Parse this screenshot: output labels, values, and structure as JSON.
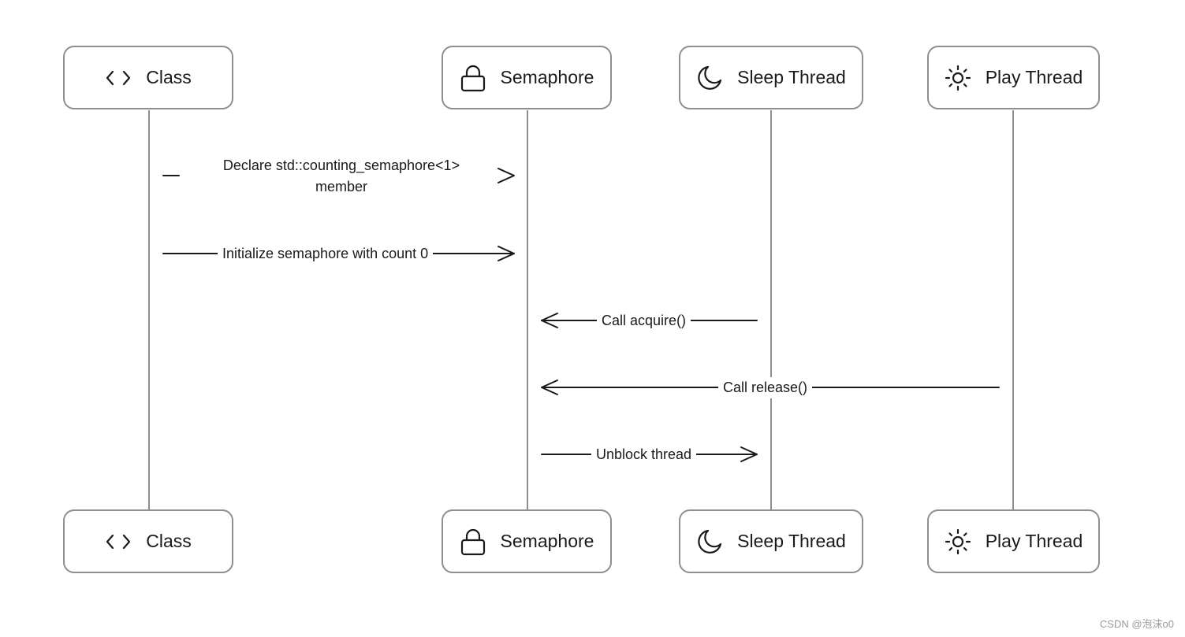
{
  "participants": [
    {
      "id": "class",
      "label": "Class",
      "icon": "code-brackets-icon"
    },
    {
      "id": "semaphore",
      "label": "Semaphore",
      "icon": "lock-icon"
    },
    {
      "id": "sleep",
      "label": "Sleep Thread",
      "icon": "moon-icon"
    },
    {
      "id": "play",
      "label": "Play Thread",
      "icon": "sun-icon"
    }
  ],
  "messages": [
    {
      "from": "class",
      "to": "semaphore",
      "label_line1": "Declare std::counting_semaphore<1>",
      "label_line2": "member"
    },
    {
      "from": "class",
      "to": "semaphore",
      "label_line1": "Initialize semaphore with count 0"
    },
    {
      "from": "sleep",
      "to": "semaphore",
      "label_line1": "Call acquire()"
    },
    {
      "from": "play",
      "to": "semaphore",
      "label_line1": "Call release()"
    },
    {
      "from": "semaphore",
      "to": "sleep",
      "label_line1": "Unblock thread"
    }
  ],
  "watermark": "CSDN @泡沫o0"
}
